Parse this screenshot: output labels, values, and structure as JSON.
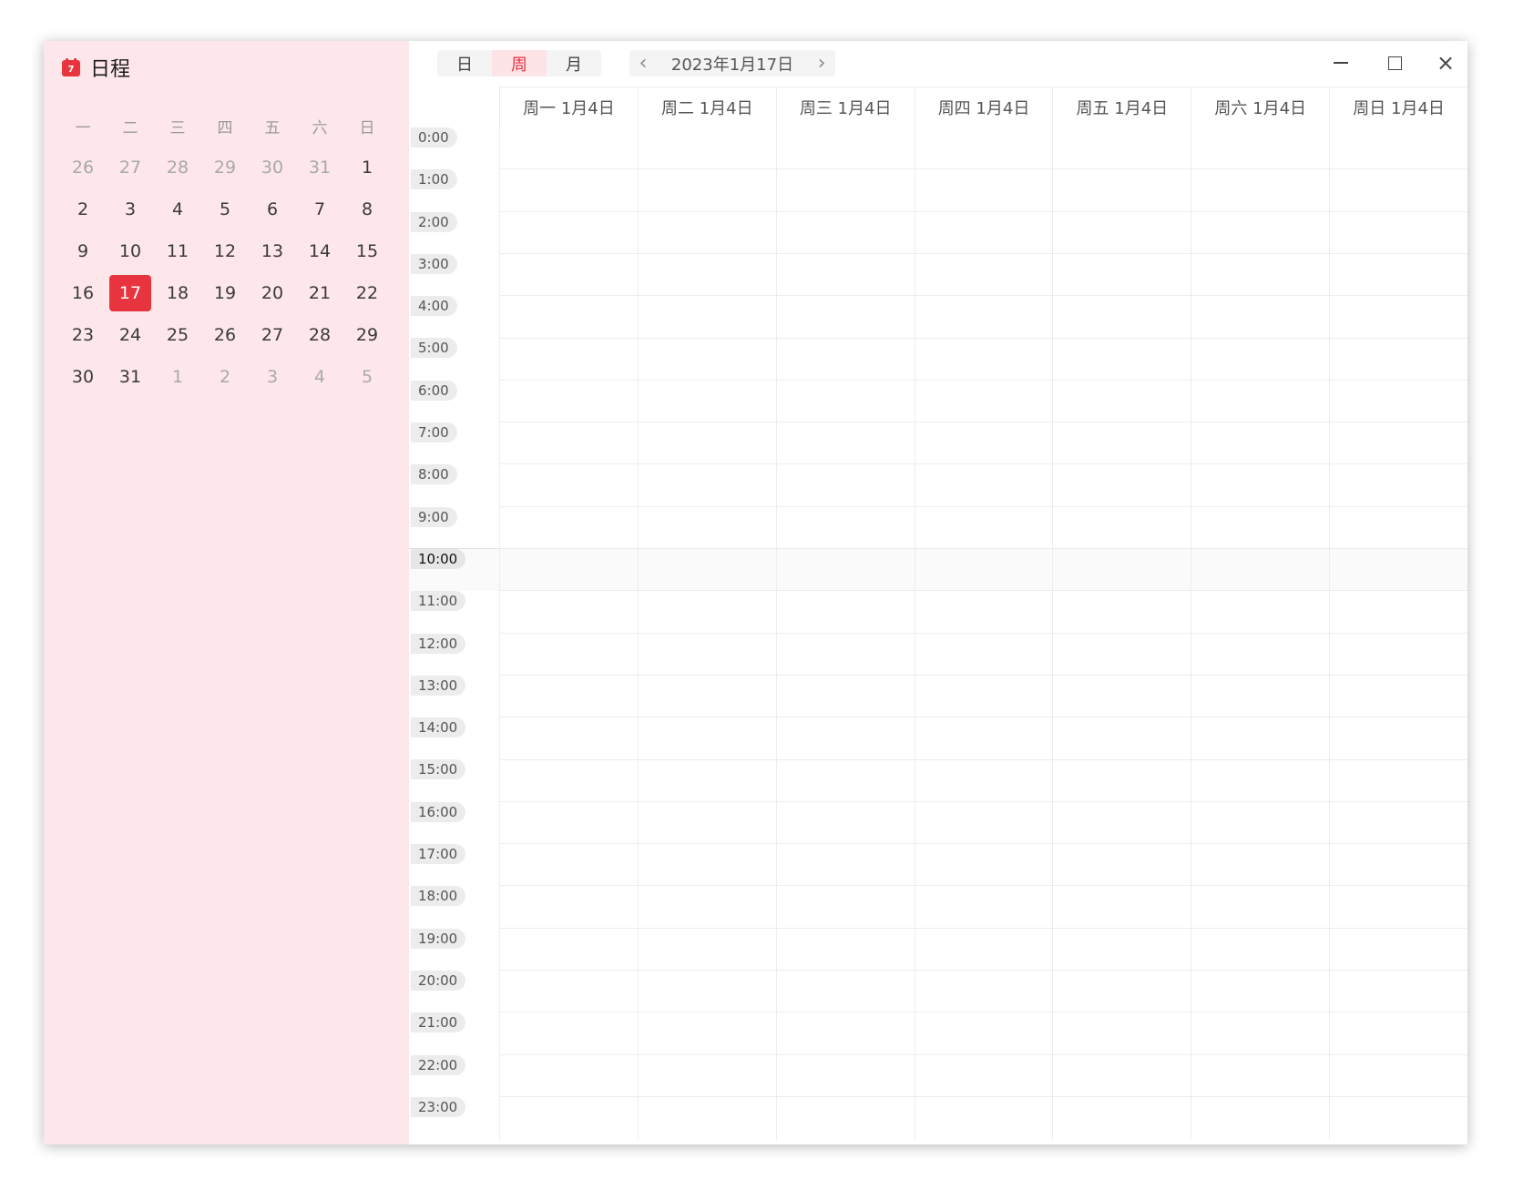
{
  "app": {
    "title": "日程",
    "icon_number": "7"
  },
  "mini_calendar": {
    "weekday_headers": [
      "一",
      "二",
      "三",
      "四",
      "五",
      "六",
      "日"
    ],
    "weeks": [
      [
        {
          "d": "26",
          "o": true
        },
        {
          "d": "27",
          "o": true
        },
        {
          "d": "28",
          "o": true
        },
        {
          "d": "29",
          "o": true
        },
        {
          "d": "30",
          "o": true
        },
        {
          "d": "31",
          "o": true
        },
        {
          "d": "1",
          "o": false
        }
      ],
      [
        {
          "d": "2",
          "o": false
        },
        {
          "d": "3",
          "o": false
        },
        {
          "d": "4",
          "o": false
        },
        {
          "d": "5",
          "o": false
        },
        {
          "d": "6",
          "o": false
        },
        {
          "d": "7",
          "o": false
        },
        {
          "d": "8",
          "o": false
        }
      ],
      [
        {
          "d": "9",
          "o": false
        },
        {
          "d": "10",
          "o": false
        },
        {
          "d": "11",
          "o": false
        },
        {
          "d": "12",
          "o": false
        },
        {
          "d": "13",
          "o": false
        },
        {
          "d": "14",
          "o": false
        },
        {
          "d": "15",
          "o": false
        }
      ],
      [
        {
          "d": "16",
          "o": false
        },
        {
          "d": "17",
          "o": false,
          "today": true
        },
        {
          "d": "18",
          "o": false
        },
        {
          "d": "19",
          "o": false
        },
        {
          "d": "20",
          "o": false
        },
        {
          "d": "21",
          "o": false
        },
        {
          "d": "22",
          "o": false
        }
      ],
      [
        {
          "d": "23",
          "o": false
        },
        {
          "d": "24",
          "o": false
        },
        {
          "d": "25",
          "o": false
        },
        {
          "d": "26",
          "o": false
        },
        {
          "d": "27",
          "o": false
        },
        {
          "d": "28",
          "o": false
        },
        {
          "d": "29",
          "o": false
        }
      ],
      [
        {
          "d": "30",
          "o": false
        },
        {
          "d": "31",
          "o": false
        },
        {
          "d": "1",
          "o": true
        },
        {
          "d": "2",
          "o": true
        },
        {
          "d": "3",
          "o": true
        },
        {
          "d": "4",
          "o": true
        },
        {
          "d": "5",
          "o": true
        }
      ]
    ]
  },
  "toolbar": {
    "view_options": [
      {
        "label": "日",
        "active": false
      },
      {
        "label": "周",
        "active": true
      },
      {
        "label": "月",
        "active": false
      }
    ],
    "prev_icon": "‹",
    "next_icon": "›",
    "current_date": "2023年1月17日"
  },
  "window_controls": {
    "minimize": "minimize-icon",
    "maximize": "maximize-icon",
    "close": "×"
  },
  "week_view": {
    "day_headers": [
      "周一 1月4日",
      "周二 1月4日",
      "周三 1月4日",
      "周四 1月4日",
      "周五 1月4日",
      "周六 1月4日",
      "周日 1月4日"
    ],
    "hours": [
      "0:00",
      "1:00",
      "2:00",
      "3:00",
      "4:00",
      "5:00",
      "6:00",
      "7:00",
      "8:00",
      "9:00",
      "10:00",
      "11:00",
      "12:00",
      "13:00",
      "14:00",
      "15:00",
      "16:00",
      "17:00",
      "18:00",
      "19:00",
      "20:00",
      "21:00",
      "22:00",
      "23:00"
    ],
    "current_hour": "10:00"
  },
  "colors": {
    "accent": "#e8343f",
    "sidebar_bg": "#fde7ea"
  }
}
